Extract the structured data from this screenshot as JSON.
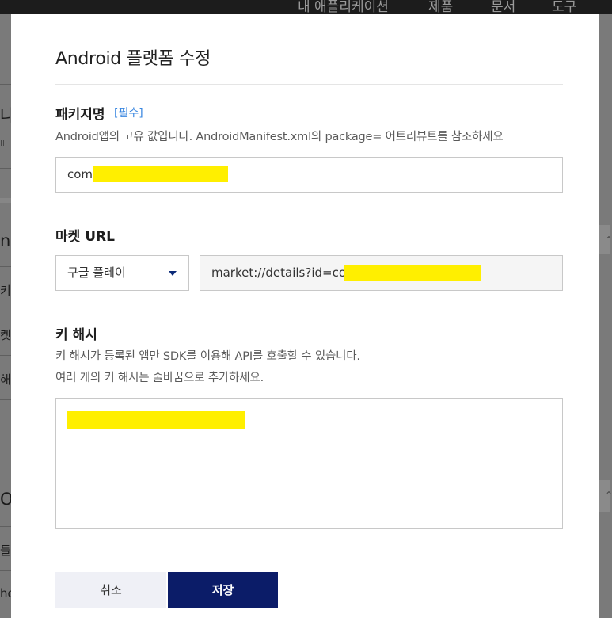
{
  "background": {
    "topbar_items": [
      "내 애플리케이션",
      "제품",
      "문서",
      "도구"
    ],
    "left_fragments": [
      "나",
      "II",
      "nc",
      "키",
      "켓",
      "해",
      "OS",
      "들",
      "ho"
    ]
  },
  "modal": {
    "title": "Android 플랫폼 수정",
    "package": {
      "label": "패키지명",
      "required": "[필수]",
      "description": "Android앱의 고유 값입니다. AndroidManifest.xml의 package= 어트리뷰트를 참조하세요",
      "value_visible": "com."
    },
    "market": {
      "label": "마켓 URL",
      "store_selected": "구글 플레이",
      "url_visible": "market://details?id=cor"
    },
    "key_hash": {
      "label": "키 해시",
      "description_lines": [
        "키 해시가 등록된 앱만 SDK를 이용해 API를 호출할 수 있습니다.",
        "여러 개의 키 해시는 줄바꿈으로 추가하세요."
      ]
    },
    "buttons": {
      "cancel": "취소",
      "save": "저장"
    }
  },
  "colors": {
    "primary": "#0b1c68",
    "required_link": "#3a87e0",
    "redaction": "#ffef00"
  }
}
